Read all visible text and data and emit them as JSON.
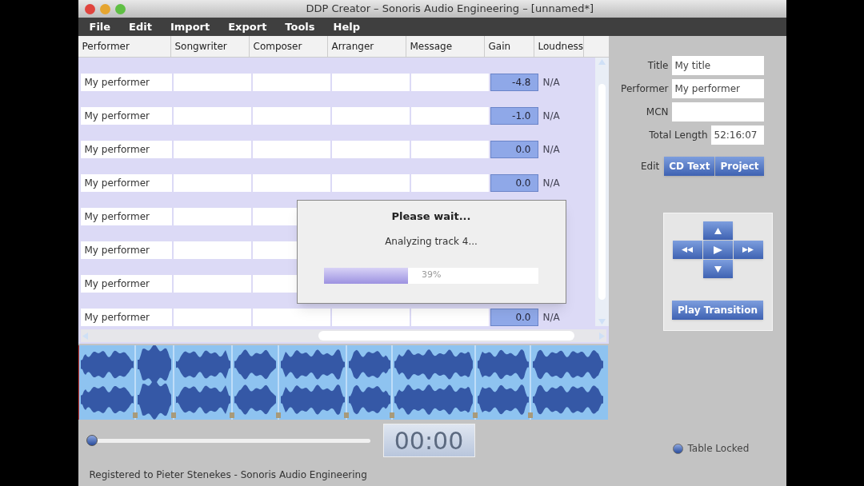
{
  "window": {
    "title": "DDP Creator – Sonoris Audio Engineering – [unnamed*]"
  },
  "menu": [
    "File",
    "Edit",
    "Import",
    "Export",
    "Tools",
    "Help"
  ],
  "table": {
    "columns": [
      "Performer",
      "Songwriter",
      "Composer",
      "Arranger",
      "Message",
      "Gain",
      "Loudness"
    ],
    "rows": [
      {
        "performer": "My performer",
        "gain": "-4.8",
        "loudness": "N/A"
      },
      {
        "performer": "My performer",
        "gain": "-1.0",
        "loudness": "N/A"
      },
      {
        "performer": "My performer",
        "gain": "0.0",
        "loudness": "N/A"
      },
      {
        "performer": "My performer",
        "gain": "0.0",
        "loudness": "N/A"
      },
      {
        "performer": "My performer"
      },
      {
        "performer": "My performer"
      },
      {
        "performer": "My performer"
      },
      {
        "performer": "My performer",
        "gain": "0.0",
        "loudness": "N/A"
      }
    ]
  },
  "dialog": {
    "title": "Please wait...",
    "message": "Analyzing track 4...",
    "progress": {
      "level": 0.39,
      "label": "39%"
    }
  },
  "properties": [
    {
      "label": "Title",
      "value": "My title"
    },
    {
      "label": "Performer",
      "value": "My performer"
    },
    {
      "label": "MCN"
    },
    {
      "label": "Total Length",
      "value": "52:16:07"
    }
  ],
  "edit": {
    "label": "Edit",
    "buttons": [
      "CD Text",
      "Project"
    ]
  },
  "transport": {
    "button": "Play Transition"
  },
  "position": {
    "level": 0
  },
  "time": "00:00",
  "table_locked": {
    "label": "Table Locked",
    "checked": true
  },
  "status_bar": "Registered to Pieter Stenekes - Sonoris Audio Engineering"
}
